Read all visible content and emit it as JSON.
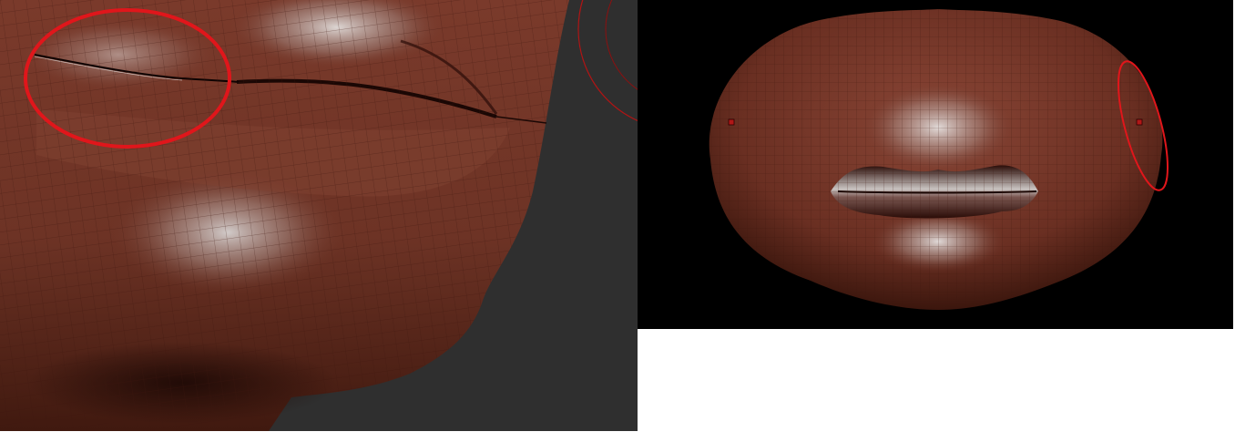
{
  "scene": {
    "left_view": "closeup-mouth-corner-seam",
    "right_view": "front-lips-mesh",
    "background_left": "#2f2f2f",
    "background_right": "#000000"
  },
  "colors": {
    "clay": "#6e3426",
    "clay_dark": "#3a1710",
    "clay_highlight": "#b9b3b0",
    "wire": "#4a1d14",
    "annotation": "#e0161b",
    "selection_point": "#b01818"
  },
  "annotations": [
    {
      "name": "seam-highlight-circle",
      "view": "left"
    },
    {
      "name": "edge-highlight-ellipse",
      "view": "right"
    }
  ]
}
